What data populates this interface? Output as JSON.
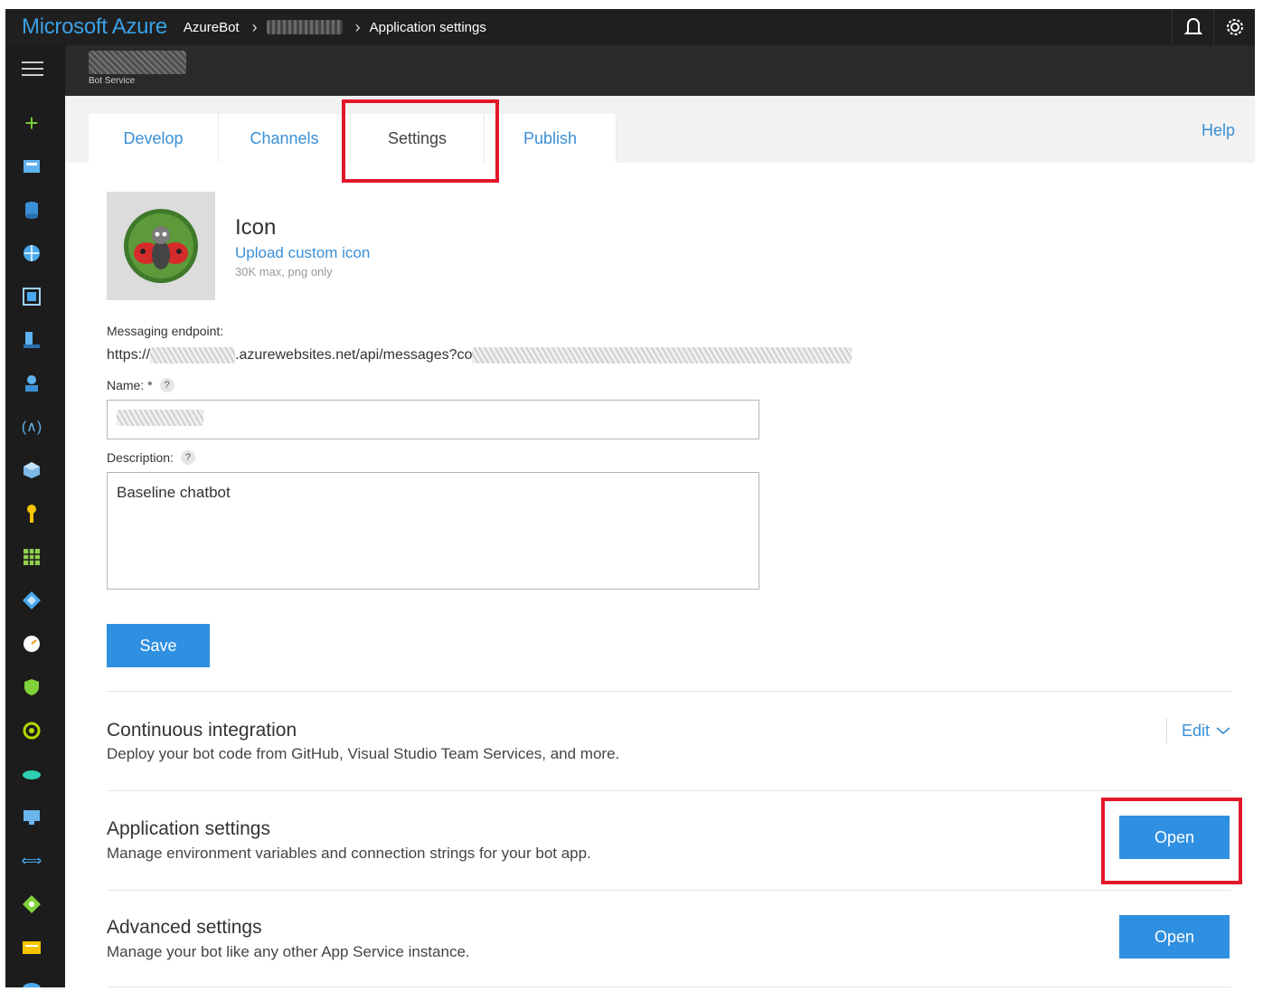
{
  "topbar": {
    "brand": "Microsoft Azure",
    "breadcrumb": [
      "AzureBot",
      "Application settings"
    ],
    "icons": [
      "notification-bell-icon",
      "settings-gear-icon"
    ]
  },
  "resource": {
    "type_label": "Bot Service"
  },
  "sidebar": {
    "icons": [
      "add-icon",
      "dashboard-icon",
      "sql-database-icon",
      "globe-icon",
      "resource-group-icon",
      "vm-icon",
      "user-icon",
      "monitor-icon",
      "cube-icon",
      "key-icon",
      "grid-icon",
      "diamond-icon",
      "gauge-icon",
      "shield-icon",
      "circle-icon",
      "cloud-icon",
      "desktop-icon",
      "arrows-icon",
      "network-icon",
      "card-icon",
      "cloud-service-icon"
    ]
  },
  "tabs": [
    {
      "label": "Develop"
    },
    {
      "label": "Channels"
    },
    {
      "label": "Settings"
    },
    {
      "label": "Publish"
    }
  ],
  "help_label": "Help",
  "icon_section": {
    "title": "Icon",
    "upload_label": "Upload custom icon",
    "hint": "30K max, png only"
  },
  "messaging": {
    "label": "Messaging endpoint:",
    "url_prefix": "https://",
    "url_middle": ".azurewebsites.net/api/messages?co"
  },
  "name_field": {
    "label": "Name: *"
  },
  "description_field": {
    "label": "Description:",
    "value": "Baseline chatbot"
  },
  "save_label": "Save",
  "sections": [
    {
      "title": "Continuous integration",
      "desc": "Deploy your bot code from GitHub, Visual Studio Team Services, and more.",
      "action": "Edit"
    },
    {
      "title": "Application settings",
      "desc": "Manage environment variables and connection strings for your bot app.",
      "action": "Open"
    },
    {
      "title": "Advanced settings",
      "desc": "Manage your bot like any other App Service instance.",
      "action": "Open"
    }
  ],
  "colors": {
    "accent": "#2f8fe0",
    "link": "#3a8fd6",
    "highlight": "#e2172a",
    "topbar": "#1f1f1f"
  }
}
